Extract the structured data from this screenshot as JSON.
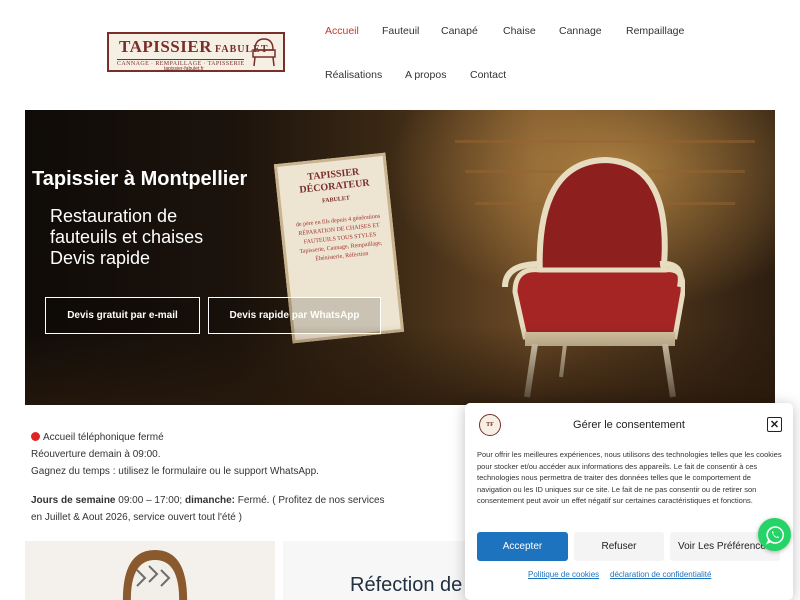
{
  "header": {
    "logo_brand": "TAPISSIER",
    "logo_brand_small": "FABULET",
    "logo_tagline": "CANNAGE · REMPAILLAGE · TAPISSERIE",
    "logo_url": "tapissier-fabulet.fr",
    "nav": [
      {
        "label": "Accueil",
        "active": true
      },
      {
        "label": "Fauteuil"
      },
      {
        "label": "Canapé"
      },
      {
        "label": "Chaise"
      },
      {
        "label": "Cannage"
      },
      {
        "label": "Rempaillage"
      },
      {
        "label": "Réalisations"
      },
      {
        "label": "A propos"
      },
      {
        "label": "Contact"
      }
    ]
  },
  "hero": {
    "title": "Tapissier à Montpellier",
    "subtitle_lines": [
      "Restauration de",
      "fauteuils et chaises",
      "Devis rapide"
    ],
    "buttons": [
      "Devis gratuit par e-mail",
      "Devis rapide par WhatsApp"
    ],
    "sign_text": "TAPISSIER DÉCORATEUR",
    "sign_small": "FABULET",
    "sign_lines": "de père en fils depuis 4 générations\nRÉPARATION DE CHAISES ET FAUTEUILS TOUS STYLES\nTapisserie, Cannage, Rempaillage,\nÉbénisterie, Réfection"
  },
  "info": {
    "status": "Accueil téléphonique fermé",
    "reopen": "Réouverture demain à 09:00.",
    "tip": "Gagnez du temps : utilisez le formulaire ou le support WhatsApp.",
    "weekdays_label": "Jours de semaine",
    "weekdays_hours": " 09:00 – 17:00; ",
    "sunday_label": "dimanche:",
    "sunday_value": " Fermé. ( Profitez de nos services",
    "summer": "en Juillet & Aout 2026, service ouvert tout l'été )",
    "status_color": "#e02424"
  },
  "lower": {
    "title": "Réfection de"
  },
  "consent": {
    "logo_text": "TF",
    "title": "Gérer le consentement",
    "text": "Pour offrir les meilleures expériences, nous utilisons des technologies telles que les cookies pour stocker et/ou accéder aux informations des appareils. Le fait de consentir à ces technologies nous permettra de traiter des données telles que le comportement de navigation ou les ID uniques sur ce site. Le fait de ne pas consentir ou de retirer son consentement peut avoir un effet négatif sur certaines caractéristiques et fonctions.",
    "accept": "Accepter",
    "refuse": "Refuser",
    "preferences": "Voir Les Préférences",
    "link_cookies": "Politique de cookies",
    "link_privacy": "déclaration de confidentialité",
    "accent_color": "#1e73be"
  },
  "whatsapp": {
    "icon": "whatsapp-icon",
    "color": "#25d366"
  }
}
